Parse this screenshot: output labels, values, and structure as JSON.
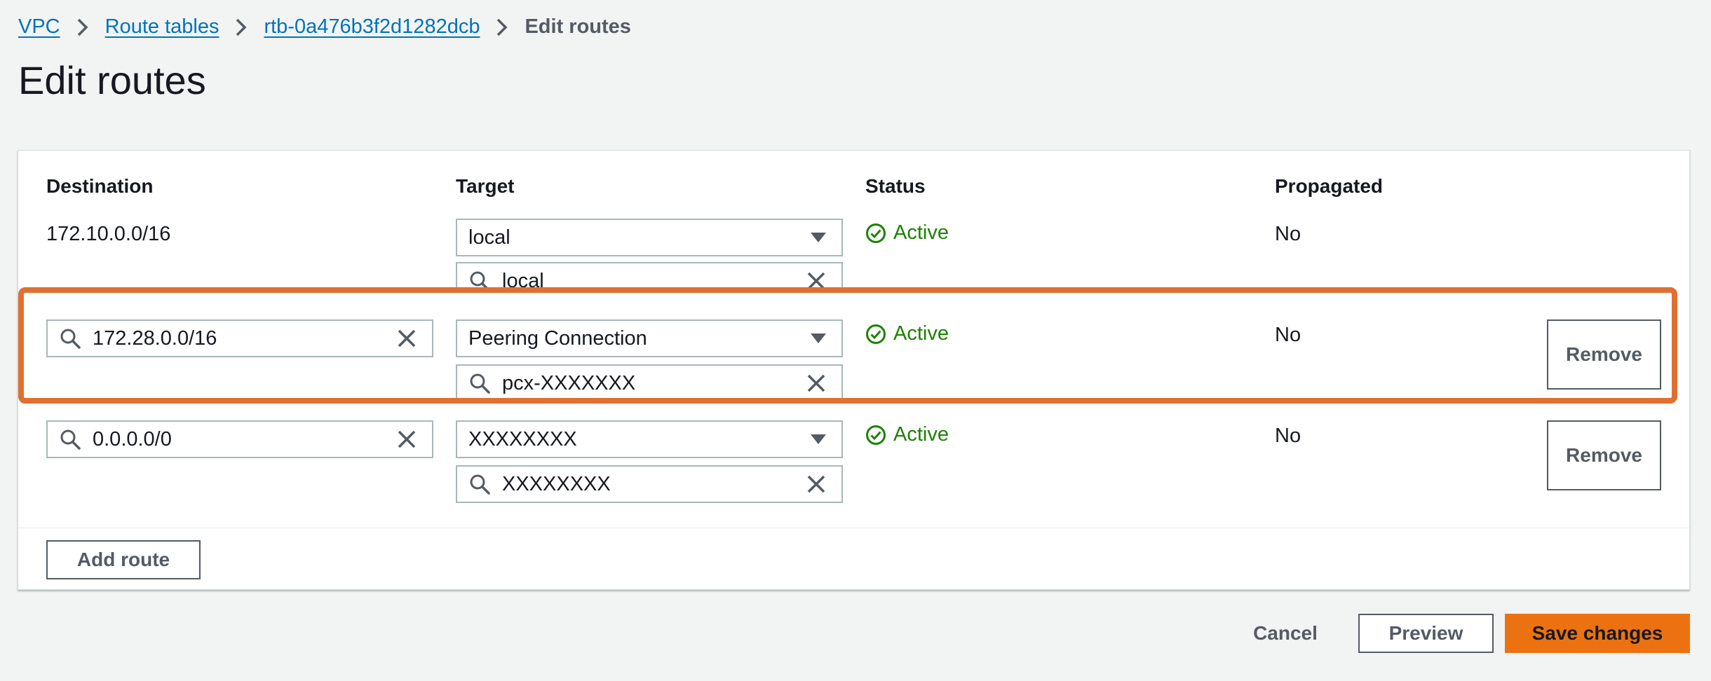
{
  "breadcrumb": {
    "items": [
      "VPC",
      "Route tables",
      "rtb-0a476b3f2d1282dcb"
    ],
    "current": "Edit routes"
  },
  "page_title": "Edit routes",
  "columns": {
    "destination": "Destination",
    "target": "Target",
    "status": "Status",
    "propagated": "Propagated"
  },
  "routes": [
    {
      "destination": "172.10.0.0/16",
      "target_type": "local",
      "target_search": "local",
      "status": "Active",
      "propagated": "No"
    },
    {
      "destination": "172.28.0.0/16",
      "target_type": "Peering Connection",
      "target_search": "pcx-XXXXXXX",
      "status": "Active",
      "propagated": "No",
      "remove_label": "Remove"
    },
    {
      "destination": "0.0.0.0/0",
      "target_type": "XXXXXXXX",
      "target_search": "XXXXXXXX",
      "status": "Active",
      "propagated": "No",
      "remove_label": "Remove"
    }
  ],
  "buttons": {
    "add_route": "Add route",
    "cancel": "Cancel",
    "preview": "Preview",
    "save": "Save changes"
  },
  "colors": {
    "link": "#0073bb",
    "status_active": "#1d8102",
    "primary": "#ec7211",
    "highlight": "#e07031"
  }
}
